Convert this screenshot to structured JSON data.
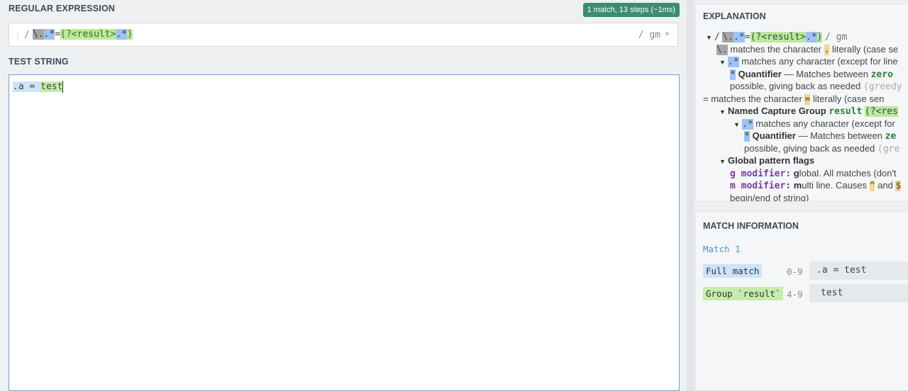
{
  "regex_section": {
    "title": "REGULAR EXPRESSION",
    "badge": "1 match, 13 steps (~1ms)",
    "delimiter_open": "/",
    "tokens": {
      "esc": "\\.",
      "dot1": ".*",
      "eq": "=",
      "grp_open": "(?<result>",
      "dot2": ".*",
      "grp_close": ")"
    },
    "flags": "/ gm"
  },
  "test_section": {
    "title": "TEST STRING",
    "match_full_prefix": ".a = ",
    "match_group": "test"
  },
  "explanation": {
    "title": "EXPLANATION",
    "header": {
      "slash": "/",
      "tail": "/ gm"
    },
    "line1": {
      "token": "\\.",
      "text": " matches the character ",
      "char": ".",
      "rest": " literally (case se"
    },
    "line2": {
      "token": ".*",
      "text": " matches any character (except for line"
    },
    "line3": {
      "token": "*",
      "kw": "Quantifier",
      "text": " — Matches between ",
      "code": "zero"
    },
    "line4": {
      "text": "possible, giving back as needed ",
      "code": "(greedy"
    },
    "line5": {
      "token": "=",
      "text": " matches the character ",
      "char": "=",
      "rest": " literally (case sen"
    },
    "line6": {
      "kw": "Named Capture Group",
      "code": "result",
      "token": "(?<res"
    },
    "line7": {
      "token": ".*",
      "text": " matches any character (except for"
    },
    "line8": {
      "token": "*",
      "kw": "Quantifier",
      "text": " — Matches between ",
      "code": "ze"
    },
    "line9": {
      "text": "possible, giving back as needed ",
      "code": "(gre"
    },
    "line10": {
      "kw": "Global pattern flags"
    },
    "line11": {
      "code": "g modifier:",
      "b": " g",
      "text": "lobal. All matches (don't"
    },
    "line12": {
      "code": "m modifier:",
      "b": " m",
      "text": "ulti line. Causes ",
      "c1": "^",
      "and": " and ",
      "c2": "$"
    },
    "line13": {
      "text": "begin/end of string)"
    }
  },
  "match_info": {
    "title": "MATCH INFORMATION",
    "match_label": "Match 1",
    "rows": [
      {
        "label": "Full match",
        "range": "0-9",
        "value": ".a = test"
      },
      {
        "label": "Group `result`",
        "range": "4-9",
        "value": "test"
      }
    ]
  }
}
